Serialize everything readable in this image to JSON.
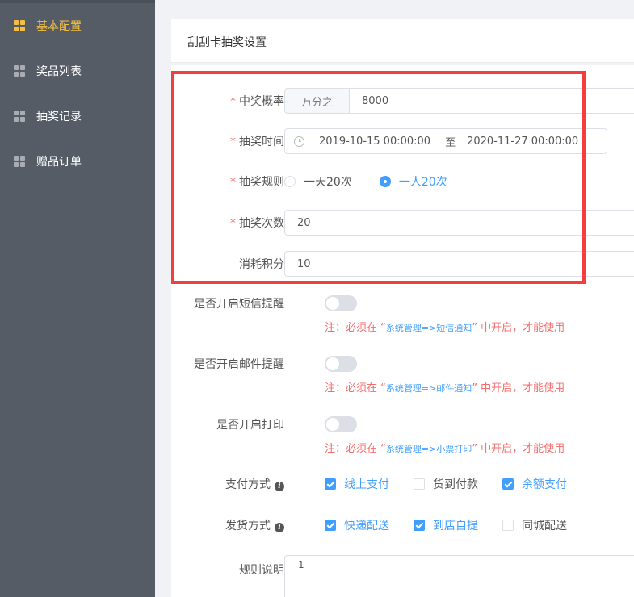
{
  "sidebar": {
    "items": [
      {
        "label": "基本配置",
        "icon": "grid-icon",
        "active": true
      },
      {
        "label": "奖品列表",
        "icon": "grid-icon",
        "active": false
      },
      {
        "label": "抽奖记录",
        "icon": "grid-icon",
        "active": false
      },
      {
        "label": "赠品订单",
        "icon": "grid-icon",
        "active": false
      }
    ]
  },
  "header": {
    "title": "刮刮卡抽奖设置"
  },
  "form": {
    "probability": {
      "label": "中奖概率",
      "prefix": "万分之",
      "value": "8000"
    },
    "time": {
      "label": "抽奖时间",
      "start": "2019-10-15 00:00:00",
      "separator": "至",
      "end": "2020-11-27 00:00:00"
    },
    "rule": {
      "label": "抽奖规则",
      "options": [
        "一天20次",
        "一人20次"
      ],
      "selected": "一人20次"
    },
    "count": {
      "label": "抽奖次数",
      "value": "20"
    },
    "points": {
      "label": "消耗积分",
      "value": "10"
    },
    "sms": {
      "label": "是否开启短信提醒",
      "enabled": false,
      "note_prefix": "注：必须在 “",
      "note_path": "系统管理=>短信通知",
      "note_suffix": "” 中开启，才能使用"
    },
    "email": {
      "label": "是否开启邮件提醒",
      "enabled": false,
      "note_prefix": "注：必须在 “",
      "note_path": "系统管理=>邮件通知",
      "note_suffix": "” 中开启，才能使用"
    },
    "print": {
      "label": "是否开启打印",
      "enabled": false,
      "note_prefix": "注：必须在 “",
      "note_path": "系统管理=>小票打印",
      "note_suffix": "” 中开启，才能使用"
    },
    "payment": {
      "label": "支付方式",
      "options": [
        {
          "label": "线上支付",
          "checked": true
        },
        {
          "label": "货到付款",
          "checked": false
        },
        {
          "label": "余额支付",
          "checked": true
        }
      ]
    },
    "delivery": {
      "label": "发货方式",
      "options": [
        {
          "label": "快递配送",
          "checked": true
        },
        {
          "label": "到店自提",
          "checked": true
        },
        {
          "label": "同城配送",
          "checked": false
        }
      ]
    },
    "description": {
      "label": "规则说明",
      "value": "1"
    }
  },
  "colors": {
    "accent": "#409eff",
    "danger": "#f56c6c",
    "highlight": "#f53d3d",
    "sidebar": "#555c66",
    "sidebar_active": "#f5c042"
  }
}
